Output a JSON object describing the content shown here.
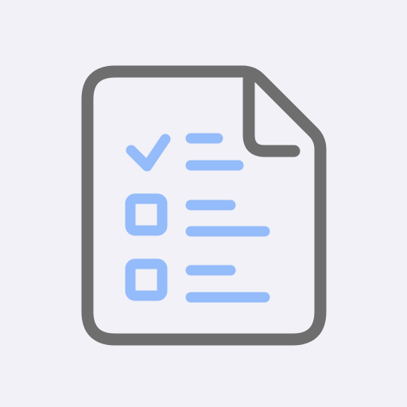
{
  "icon": {
    "name": "checklist-document-icon",
    "checklist_items": [
      {
        "name": "item-1",
        "state": "checked"
      },
      {
        "name": "item-2",
        "state": "unchecked"
      },
      {
        "name": "item-3",
        "state": "unchecked"
      }
    ]
  },
  "colors": {
    "background": "#F1F1F7",
    "outline": "#6E6E6E",
    "accent": "#94BBFA",
    "paper": "#F1F1F7"
  }
}
